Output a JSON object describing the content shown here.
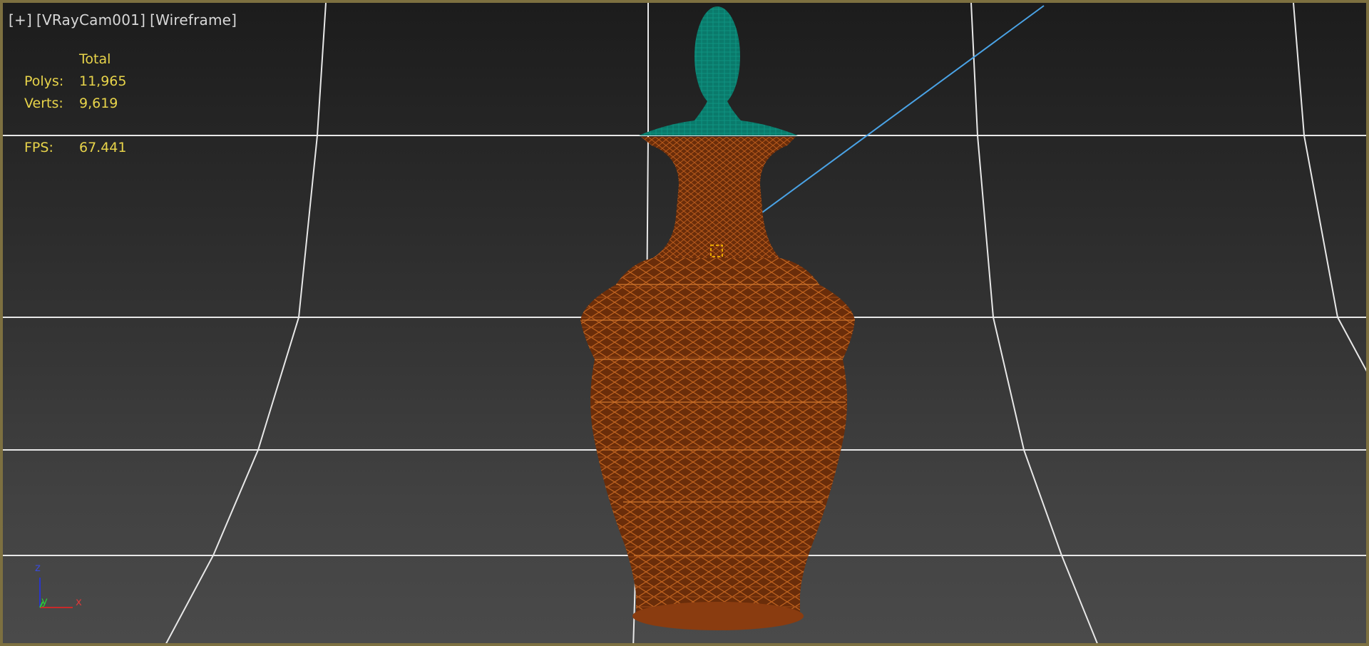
{
  "viewport": {
    "labels": {
      "plus": "[+]",
      "camera": "[VRayCam001]",
      "shading": "[Wireframe]"
    },
    "stats": {
      "header": "Total",
      "polys_label": "Polys:",
      "polys_value": "11,965",
      "verts_label": "Verts:",
      "verts_value": "9,619",
      "fps_label": "FPS:",
      "fps_value": "67.441"
    },
    "axis": {
      "z": "z",
      "y": "y",
      "x": "x"
    },
    "colors": {
      "border": "#7d7040",
      "stats_text": "#e8d44a",
      "grid_line": "#e8e8e8",
      "vase_wire": "#8a3c10",
      "lid_wire": "#0b8575",
      "target_line": "#4aa3e6"
    },
    "objects": [
      "vase",
      "lid",
      "camera-target-line"
    ]
  }
}
